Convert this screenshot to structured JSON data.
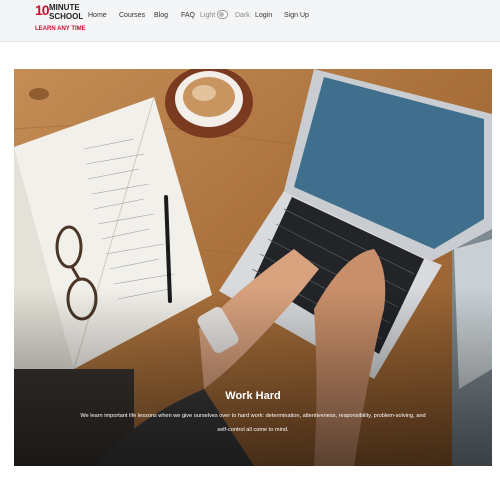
{
  "logo": {
    "number": "10",
    "word1": "MINUTE",
    "word2": "SCHOOL",
    "tagline": "LEARN ANY TIME"
  },
  "nav": {
    "links": [
      "Home",
      "Courses",
      "Blog",
      "FAQ"
    ],
    "theme_light": "Light",
    "theme_dark": "Dark",
    "login": "Login",
    "signup": "Sign Up"
  },
  "hero": {
    "title": "Work Hard",
    "text": "We learn important life lessons when we give ourselves over to hard work: determination, attentiveness, responsibility, problem-solving, and self-control all come to mind.",
    "prev_icon": "‹"
  },
  "colors": {
    "brand_red": "#c8102e",
    "navbar_bg": "#f4f5f7",
    "table_wood": "#b07a45"
  }
}
